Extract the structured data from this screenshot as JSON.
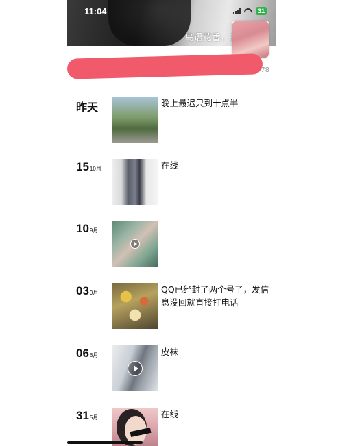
{
  "status": {
    "time": "11:04",
    "battery": "31"
  },
  "profile": {
    "nickname": "鸟语花香，1",
    "count": "78"
  },
  "posts": [
    {
      "day": "昨天",
      "month": "",
      "caption": "晚上最迟只到十点半"
    },
    {
      "day": "15",
      "month": "10月",
      "caption": "在线"
    },
    {
      "day": "10",
      "month": "9月",
      "caption": ""
    },
    {
      "day": "03",
      "month": "9月",
      "caption": "QQ已经封了两个号了，发信息没回就直接打电话"
    },
    {
      "day": "06",
      "month": "6月",
      "caption": "皮袜"
    },
    {
      "day": "31",
      "month": "5月",
      "caption": "在线"
    }
  ],
  "icons": {
    "signal": "signal-icon",
    "wifi": "wifi-icon",
    "battery": "battery-icon",
    "play": "play-icon"
  }
}
